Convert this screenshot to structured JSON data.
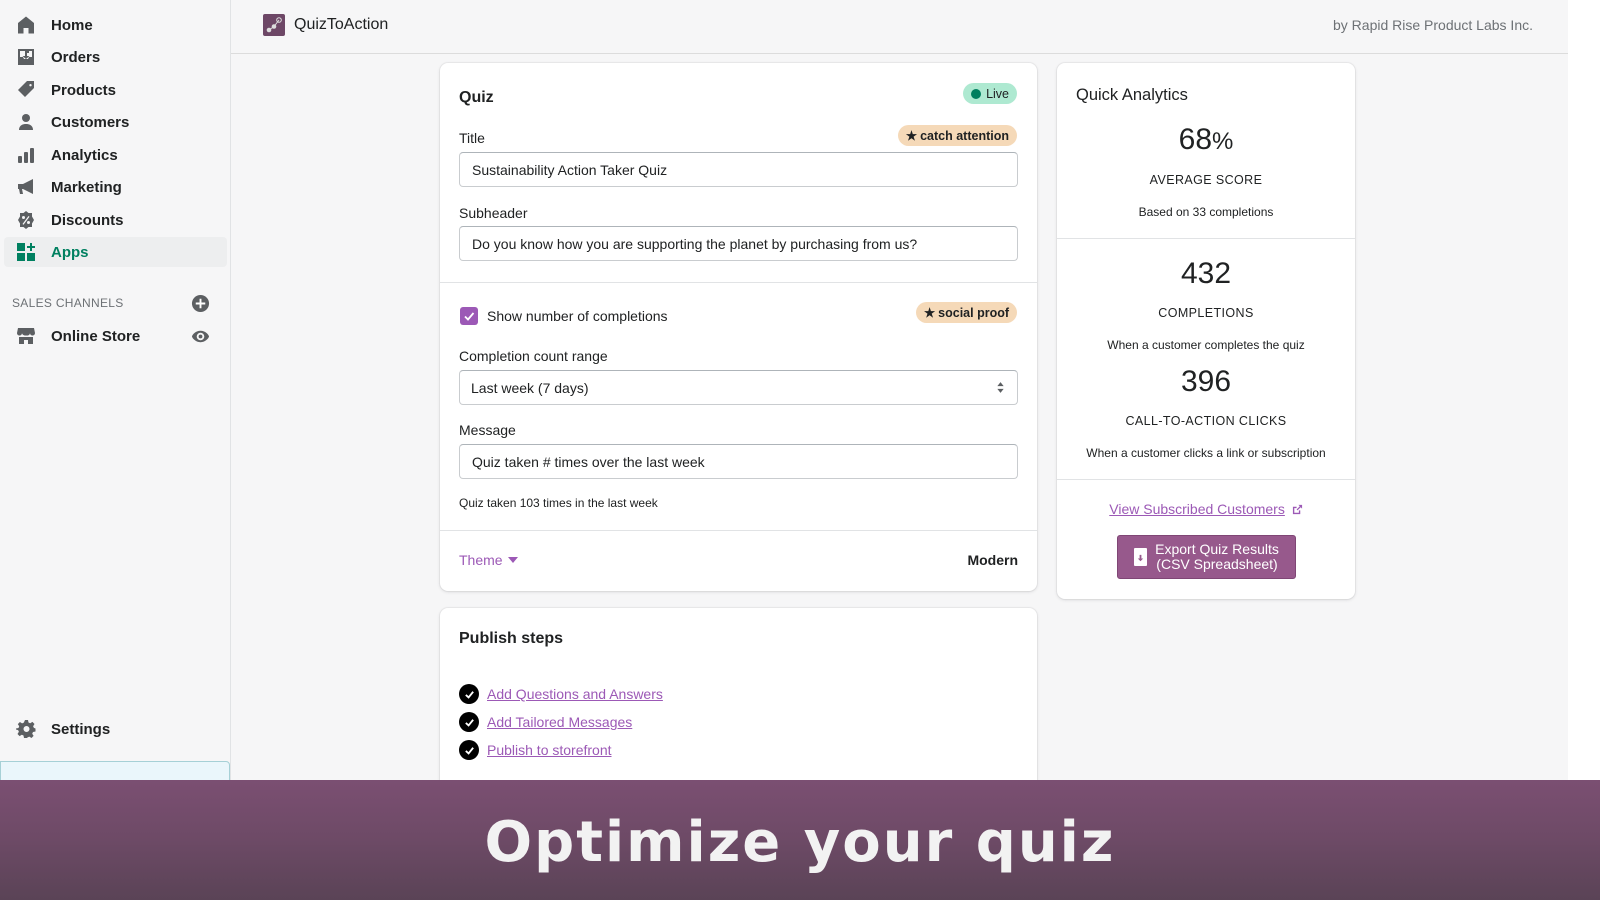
{
  "sidebar": {
    "items": [
      {
        "label": "Home",
        "icon": "home-icon"
      },
      {
        "label": "Orders",
        "icon": "orders-icon"
      },
      {
        "label": "Products",
        "icon": "tag-icon"
      },
      {
        "label": "Customers",
        "icon": "person-icon"
      },
      {
        "label": "Analytics",
        "icon": "bar-chart-icon"
      },
      {
        "label": "Marketing",
        "icon": "megaphone-icon"
      },
      {
        "label": "Discounts",
        "icon": "discount-icon"
      },
      {
        "label": "Apps",
        "icon": "apps-icon",
        "active": true
      }
    ],
    "sales_channels_label": "SALES CHANNELS",
    "online_store_label": "Online Store",
    "settings_label": "Settings"
  },
  "topbar": {
    "app_name": "QuizToAction",
    "vendor": "by Rapid Rise Product Labs Inc."
  },
  "quiz_card": {
    "title": "Quiz",
    "status_badge": "Live",
    "title_label": "Title",
    "title_badge": "catch attention",
    "title_value": "Sustainability Action Taker Quiz",
    "subheader_label": "Subheader",
    "subheader_value": "Do you know how you are supporting the planet by purchasing from us?",
    "show_completions_label": "Show number of completions",
    "show_completions_checked": true,
    "social_badge": "social proof",
    "range_label": "Completion count range",
    "range_value": "Last week (7 days)",
    "message_label": "Message",
    "message_value": "Quiz taken # times over the last week",
    "message_preview": "Quiz taken 103 times in the last week",
    "theme_label": "Theme",
    "theme_value": "Modern"
  },
  "publish_card": {
    "title": "Publish steps",
    "steps": [
      {
        "label": "Add Questions and Answers",
        "done": true
      },
      {
        "label": "Add Tailored Messages",
        "done": true
      },
      {
        "label": "Publish to storefront",
        "done": true
      }
    ]
  },
  "analytics_card": {
    "title": "Quick Analytics",
    "average_score_value": "68",
    "average_score_unit": "%",
    "average_score_label": "AVERAGE SCORE",
    "average_score_desc": "Based on 33 completions",
    "completions_value": "432",
    "completions_label": "COMPLETIONS",
    "completions_desc": "When a customer completes the quiz",
    "cta_value": "396",
    "cta_label": "CALL-TO-ACTION CLICKS",
    "cta_desc": "When a customer clicks a link or subscription",
    "view_link": "View Subscribed Customers",
    "export_line1": "Export Quiz Results",
    "export_line2": "(CSV Spreadsheet)"
  },
  "banner": {
    "text": "Optimize your quiz"
  },
  "colors": {
    "accent": "#9c59b6",
    "brand": "#97598c",
    "live": "#007f5f",
    "banner": "#6d4a66"
  }
}
